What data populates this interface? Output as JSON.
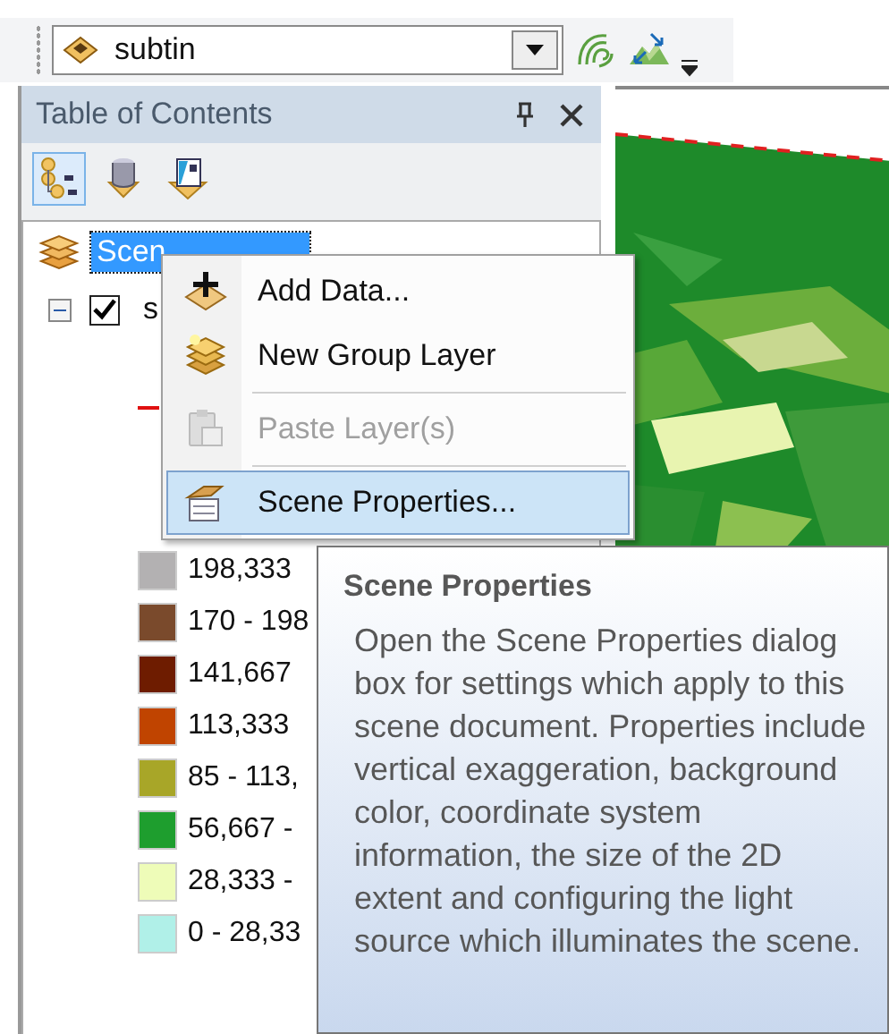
{
  "toolbar": {
    "layer_combo": {
      "value": "subtin"
    }
  },
  "toc": {
    "title": "Table of Contents",
    "tools": [
      {
        "kind": "list-by-drawing-order",
        "selected": true
      },
      {
        "kind": "list-by-source",
        "selected": false
      },
      {
        "kind": "list-by-visibility",
        "selected": false
      }
    ],
    "tree": [
      {
        "label": "Scen",
        "selected": true,
        "children": [
          {
            "label": "s",
            "checked": true,
            "expanded": true,
            "legend": [
              {
                "label": "198,333",
                "color": "#b3b1b2"
              },
              {
                "label": "170 - 198",
                "color": "#7a4a2c"
              },
              {
                "label": "141,667",
                "color": "#6e1c00"
              },
              {
                "label": "113,333",
                "color": "#c04400"
              },
              {
                "label": "85 - 113,",
                "color": "#a8a628"
              },
              {
                "label": "56,667 -",
                "color": "#1e9e2e"
              },
              {
                "label": "28,333 -",
                "color": "#eefcb8"
              },
              {
                "label": "0 - 28,33",
                "color": "#b0f0e8"
              }
            ]
          }
        ]
      }
    ]
  },
  "context_menu": {
    "items": [
      {
        "kind": "add",
        "label": "Add Data...",
        "disabled": false,
        "selected": false
      },
      {
        "kind": "group",
        "label": "New Group Layer",
        "disabled": false,
        "selected": false
      },
      {
        "kind": "separator"
      },
      {
        "kind": "paste",
        "label": "Paste Layer(s)",
        "disabled": true,
        "selected": false
      },
      {
        "kind": "separator"
      },
      {
        "kind": "properties",
        "label": "Scene Properties...",
        "disabled": false,
        "selected": true
      }
    ]
  },
  "tooltip": {
    "title": "Scene Properties",
    "text": "Open the Scene Properties dialog box for settings which apply to this scene document. Properties include vertical exaggeration, background color, coordinate system information, the size of the 2D extent and configuring the light source which illuminates the scene."
  }
}
